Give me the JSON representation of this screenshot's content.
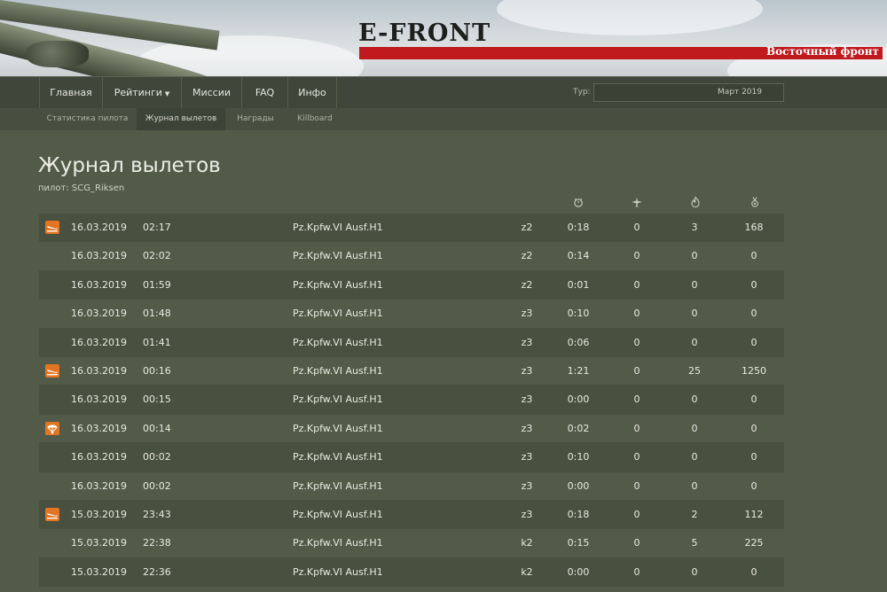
{
  "header": {
    "logo": "E-FRONT",
    "subtitle": "Восточный фронт"
  },
  "nav": {
    "items": [
      {
        "label": "Главная"
      },
      {
        "label": "Рейтинги",
        "has_caret": true
      },
      {
        "label": "Миссии"
      },
      {
        "label": "FAQ"
      },
      {
        "label": "Инфо"
      }
    ],
    "tour_label": "Тур:",
    "tour_value": "Март 2019"
  },
  "subnav": {
    "items": [
      {
        "label": "Статистика пилота",
        "active": false
      },
      {
        "label": "Журнал вылетов",
        "active": true
      },
      {
        "label": "Награды",
        "active": false
      },
      {
        "label": "Killboard",
        "active": false
      }
    ]
  },
  "page": {
    "title": "Журнал вылетов",
    "pilot_line": "пилот: SCG_Riksen"
  },
  "columns": {
    "icons": [
      "stopwatch-icon",
      "aircraft-icon",
      "fire-icon",
      "medal-icon"
    ]
  },
  "colors": {
    "accent": "#e37423",
    "brand_red": "#c0191e"
  },
  "sorties": [
    {
      "status_icon": "landing-icon",
      "date": "16.03.2019",
      "time": "02:17",
      "vehicle": "Pz.Kpfw.VI Ausf.H1",
      "zone": "z2",
      "duration": "0:18",
      "air_kills": "0",
      "ground_kills": "3",
      "points": "168"
    },
    {
      "status_icon": "",
      "date": "16.03.2019",
      "time": "02:02",
      "vehicle": "Pz.Kpfw.VI Ausf.H1",
      "zone": "z2",
      "duration": "0:14",
      "air_kills": "0",
      "ground_kills": "0",
      "points": "0"
    },
    {
      "status_icon": "",
      "date": "16.03.2019",
      "time": "01:59",
      "vehicle": "Pz.Kpfw.VI Ausf.H1",
      "zone": "z2",
      "duration": "0:01",
      "air_kills": "0",
      "ground_kills": "0",
      "points": "0"
    },
    {
      "status_icon": "",
      "date": "16.03.2019",
      "time": "01:48",
      "vehicle": "Pz.Kpfw.VI Ausf.H1",
      "zone": "z3",
      "duration": "0:10",
      "air_kills": "0",
      "ground_kills": "0",
      "points": "0"
    },
    {
      "status_icon": "",
      "date": "16.03.2019",
      "time": "01:41",
      "vehicle": "Pz.Kpfw.VI Ausf.H1",
      "zone": "z3",
      "duration": "0:06",
      "air_kills": "0",
      "ground_kills": "0",
      "points": "0"
    },
    {
      "status_icon": "landing-icon",
      "date": "16.03.2019",
      "time": "00:16",
      "vehicle": "Pz.Kpfw.VI Ausf.H1",
      "zone": "z3",
      "duration": "1:21",
      "air_kills": "0",
      "ground_kills": "25",
      "points": "1250"
    },
    {
      "status_icon": "",
      "date": "16.03.2019",
      "time": "00:15",
      "vehicle": "Pz.Kpfw.VI Ausf.H1",
      "zone": "z3",
      "duration": "0:00",
      "air_kills": "0",
      "ground_kills": "0",
      "points": "0"
    },
    {
      "status_icon": "parachute-icon",
      "date": "16.03.2019",
      "time": "00:14",
      "vehicle": "Pz.Kpfw.VI Ausf.H1",
      "zone": "z3",
      "duration": "0:02",
      "air_kills": "0",
      "ground_kills": "0",
      "points": "0"
    },
    {
      "status_icon": "",
      "date": "16.03.2019",
      "time": "00:02",
      "vehicle": "Pz.Kpfw.VI Ausf.H1",
      "zone": "z3",
      "duration": "0:10",
      "air_kills": "0",
      "ground_kills": "0",
      "points": "0"
    },
    {
      "status_icon": "",
      "date": "16.03.2019",
      "time": "00:02",
      "vehicle": "Pz.Kpfw.VI Ausf.H1",
      "zone": "z3",
      "duration": "0:00",
      "air_kills": "0",
      "ground_kills": "0",
      "points": "0"
    },
    {
      "status_icon": "landing-icon",
      "date": "15.03.2019",
      "time": "23:43",
      "vehicle": "Pz.Kpfw.VI Ausf.H1",
      "zone": "z3",
      "duration": "0:18",
      "air_kills": "0",
      "ground_kills": "2",
      "points": "112"
    },
    {
      "status_icon": "",
      "date": "15.03.2019",
      "time": "22:38",
      "vehicle": "Pz.Kpfw.VI Ausf.H1",
      "zone": "k2",
      "duration": "0:15",
      "air_kills": "0",
      "ground_kills": "5",
      "points": "225"
    },
    {
      "status_icon": "",
      "date": "15.03.2019",
      "time": "22:36",
      "vehicle": "Pz.Kpfw.VI Ausf.H1",
      "zone": "k2",
      "duration": "0:00",
      "air_kills": "0",
      "ground_kills": "0",
      "points": "0"
    }
  ]
}
